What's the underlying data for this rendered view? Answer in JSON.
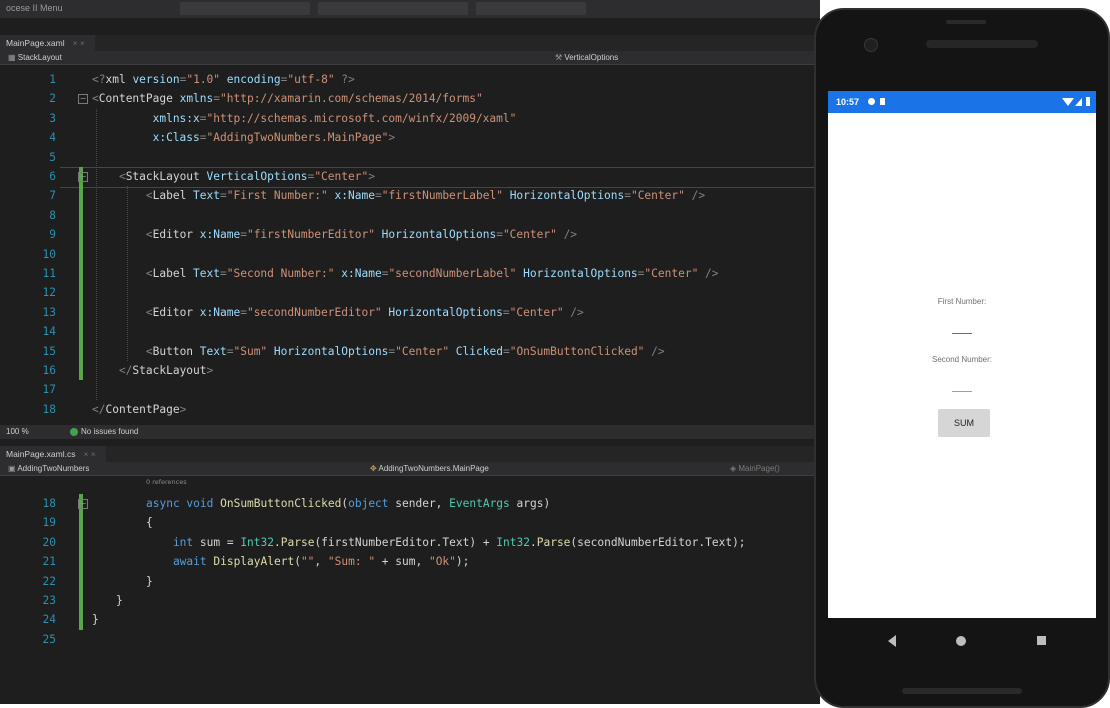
{
  "ide": {
    "menu_fragment": "ocese II Menu",
    "upper": {
      "tab": "MainPage.xaml",
      "nav_left": "StackLayout",
      "nav_right": "VerticalOptions",
      "lines": [
        {
          "n": "1",
          "tokens": [
            [
              "punct",
              "<?"
            ],
            [
              "tag",
              "xml "
            ],
            [
              "attr",
              "version"
            ],
            [
              "punct",
              "="
            ],
            [
              "str",
              "\"1.0\""
            ],
            [
              "attr",
              " encoding"
            ],
            [
              "punct",
              "="
            ],
            [
              "str",
              "\"utf-8\""
            ],
            [
              "punct",
              " ?>"
            ]
          ]
        },
        {
          "n": "2",
          "tokens": [
            [
              "punct",
              "<"
            ],
            [
              "tag",
              "ContentPage "
            ],
            [
              "attr",
              "xmlns"
            ],
            [
              "punct",
              "="
            ],
            [
              "str",
              "\"http://xamarin.com/schemas/2014/forms\""
            ]
          ]
        },
        {
          "n": "3",
          "tokens": [
            [
              "attr",
              "         xmlns:x"
            ],
            [
              "punct",
              "="
            ],
            [
              "str",
              "\"http://schemas.microsoft.com/winfx/2009/xaml\""
            ]
          ]
        },
        {
          "n": "4",
          "tokens": [
            [
              "attr",
              "         x:Class"
            ],
            [
              "punct",
              "="
            ],
            [
              "str",
              "\"AddingTwoNumbers.MainPage\""
            ],
            [
              "punct",
              ">"
            ]
          ]
        },
        {
          "n": "5",
          "tokens": []
        },
        {
          "n": "6",
          "tokens": [
            [
              "punct",
              "    <"
            ],
            [
              "tag",
              "StackLayout "
            ],
            [
              "attr",
              "VerticalOptions"
            ],
            [
              "punct",
              "="
            ],
            [
              "str",
              "\"Center\""
            ],
            [
              "punct",
              ">"
            ]
          ]
        },
        {
          "n": "7",
          "tokens": [
            [
              "punct",
              "        <"
            ],
            [
              "tag",
              "Label "
            ],
            [
              "attr",
              "Text"
            ],
            [
              "punct",
              "="
            ],
            [
              "str",
              "\"First Number:\""
            ],
            [
              "attr",
              " x:Name"
            ],
            [
              "punct",
              "="
            ],
            [
              "str",
              "\"firstNumberLabel\""
            ],
            [
              "attr",
              " HorizontalOptions"
            ],
            [
              "punct",
              "="
            ],
            [
              "str",
              "\"Center\""
            ],
            [
              "punct",
              " />"
            ]
          ]
        },
        {
          "n": "8",
          "tokens": []
        },
        {
          "n": "9",
          "tokens": [
            [
              "punct",
              "        <"
            ],
            [
              "tag",
              "Editor "
            ],
            [
              "attr",
              "x:Name"
            ],
            [
              "punct",
              "="
            ],
            [
              "str",
              "\"firstNumberEditor\""
            ],
            [
              "attr",
              " HorizontalOptions"
            ],
            [
              "punct",
              "="
            ],
            [
              "str",
              "\"Center\""
            ],
            [
              "punct",
              " />"
            ]
          ]
        },
        {
          "n": "10",
          "tokens": []
        },
        {
          "n": "11",
          "tokens": [
            [
              "punct",
              "        <"
            ],
            [
              "tag",
              "Label "
            ],
            [
              "attr",
              "Text"
            ],
            [
              "punct",
              "="
            ],
            [
              "str",
              "\"Second Number:\""
            ],
            [
              "attr",
              " x:Name"
            ],
            [
              "punct",
              "="
            ],
            [
              "str",
              "\"secondNumberLabel\""
            ],
            [
              "attr",
              " HorizontalOptions"
            ],
            [
              "punct",
              "="
            ],
            [
              "str",
              "\"Center\""
            ],
            [
              "punct",
              " />"
            ]
          ]
        },
        {
          "n": "12",
          "tokens": []
        },
        {
          "n": "13",
          "tokens": [
            [
              "punct",
              "        <"
            ],
            [
              "tag",
              "Editor "
            ],
            [
              "attr",
              "x:Name"
            ],
            [
              "punct",
              "="
            ],
            [
              "str",
              "\"secondNumberEditor\""
            ],
            [
              "attr",
              " HorizontalOptions"
            ],
            [
              "punct",
              "="
            ],
            [
              "str",
              "\"Center\""
            ],
            [
              "punct",
              " />"
            ]
          ]
        },
        {
          "n": "14",
          "tokens": []
        },
        {
          "n": "15",
          "tokens": [
            [
              "punct",
              "        <"
            ],
            [
              "tag",
              "Button "
            ],
            [
              "attr",
              "Text"
            ],
            [
              "punct",
              "="
            ],
            [
              "str",
              "\"Sum\""
            ],
            [
              "attr",
              " HorizontalOptions"
            ],
            [
              "punct",
              "="
            ],
            [
              "str",
              "\"Center\""
            ],
            [
              "attr",
              " Clicked"
            ],
            [
              "punct",
              "="
            ],
            [
              "str",
              "\"OnSumButtonClicked\""
            ],
            [
              "punct",
              " />"
            ]
          ]
        },
        {
          "n": "16",
          "tokens": [
            [
              "punct",
              "    </"
            ],
            [
              "tag",
              "StackLayout"
            ],
            [
              "punct",
              ">"
            ]
          ]
        },
        {
          "n": "17",
          "tokens": []
        },
        {
          "n": "18",
          "tokens": [
            [
              "punct",
              "</"
            ],
            [
              "tag",
              "ContentPage"
            ],
            [
              "punct",
              ">"
            ]
          ]
        }
      ]
    },
    "status": {
      "zoom": "100 %",
      "issues": "No issues found"
    },
    "lower": {
      "tab": "MainPage.xaml.cs",
      "nav_left": "AddingTwoNumbers",
      "nav_mid": "AddingTwoNumbers.MainPage",
      "nav_right": "MainPage()",
      "refs": "0 references",
      "lines": [
        {
          "n": "18",
          "tokens": [
            [
              "kw",
              "async "
            ],
            [
              "kw",
              "void "
            ],
            [
              "meth",
              "OnSumButtonClicked"
            ],
            [
              "id",
              "("
            ],
            [
              "kw",
              "object "
            ],
            [
              "id",
              "sender, "
            ],
            [
              "type",
              "EventArgs "
            ],
            [
              "id",
              "args)"
            ]
          ]
        },
        {
          "n": "19",
          "tokens": [
            [
              "id",
              "{"
            ]
          ]
        },
        {
          "n": "20",
          "tokens": [
            [
              "kw",
              "    int "
            ],
            [
              "id",
              "sum = "
            ],
            [
              "type",
              "Int32"
            ],
            [
              "id",
              "."
            ],
            [
              "meth",
              "Parse"
            ],
            [
              "id",
              "(firstNumberEditor.Text) + "
            ],
            [
              "type",
              "Int32"
            ],
            [
              "id",
              "."
            ],
            [
              "meth",
              "Parse"
            ],
            [
              "id",
              "(secondNumberEditor.Text);"
            ]
          ]
        },
        {
          "n": "21",
          "tokens": [
            [
              "kw",
              "    await "
            ],
            [
              "meth",
              "DisplayAlert"
            ],
            [
              "id",
              "("
            ],
            [
              "str",
              "\"\""
            ],
            [
              "id",
              ", "
            ],
            [
              "str",
              "\"Sum: \""
            ],
            [
              "id",
              " + sum, "
            ],
            [
              "str",
              "\"Ok\""
            ],
            [
              "id",
              ");"
            ]
          ]
        },
        {
          "n": "22",
          "tokens": [
            [
              "id",
              "}"
            ]
          ]
        },
        {
          "n": "23",
          "tokens": [
            [
              "id",
              "}"
            ]
          ]
        },
        {
          "n": "24",
          "tokens": [
            [
              "id",
              "}"
            ]
          ]
        },
        {
          "n": "25",
          "tokens": []
        }
      ]
    }
  },
  "phone": {
    "time": "10:57",
    "first_label": "First Number:",
    "second_label": "Second Number:",
    "button": "SUM",
    "editor_active_color": "#e53935",
    "editor_idle_color": "#9e9e9e"
  }
}
